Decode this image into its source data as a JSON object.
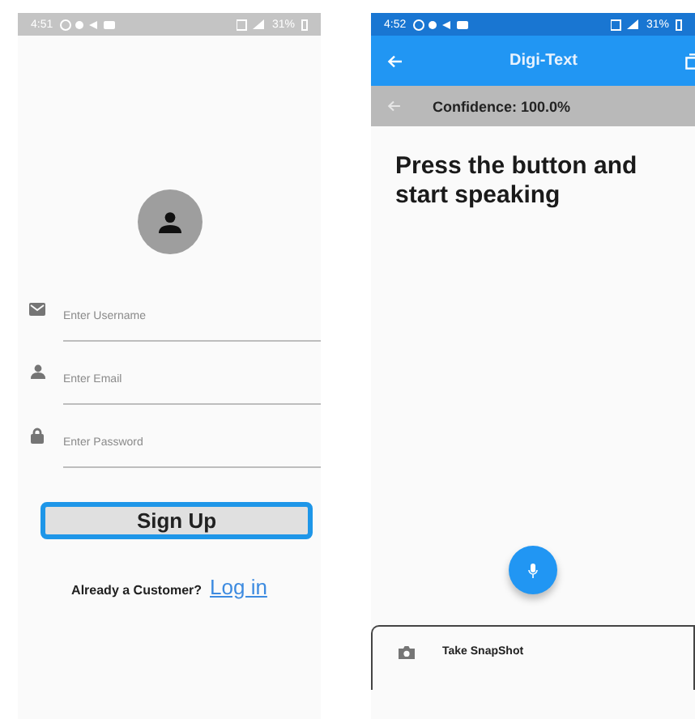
{
  "login_screen": {
    "status_bar": {
      "time": "4:51",
      "battery": "31%"
    },
    "fields": [
      {
        "kind": "username",
        "placeholder": "Enter Username"
      },
      {
        "kind": "email",
        "placeholder": "Enter Email"
      },
      {
        "kind": "password",
        "placeholder": "Enter Password"
      }
    ],
    "sign_up_button": "Sign Up",
    "prompt": "Already a Customer?",
    "login_link": "Log in"
  },
  "speech_screen": {
    "status_bar": {
      "time": "4:52",
      "battery": "31%"
    },
    "title": "Digi-Text",
    "confidence": "Confidence: 100.0%",
    "message": "Press the button and start speaking",
    "snapshot_button": "Take SnapShot"
  }
}
